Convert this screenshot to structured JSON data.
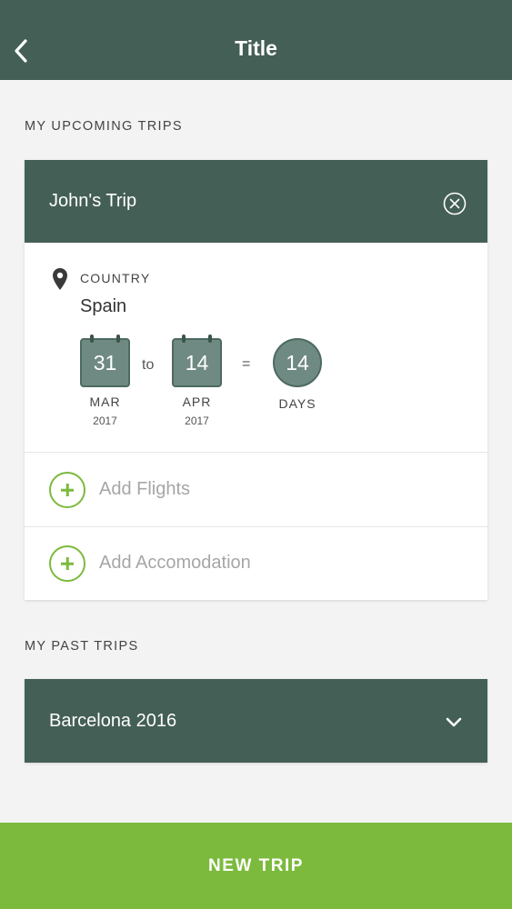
{
  "header": {
    "title": "Title"
  },
  "upcoming": {
    "section_label": "MY UPCOMING TRIPS",
    "trip": {
      "name": "John's Trip",
      "country_label": "COUNTRY",
      "country_value": "Spain",
      "start": {
        "day": "31",
        "month": "MAR",
        "year": "2017"
      },
      "to_text": "to",
      "end": {
        "day": "14",
        "month": "APR",
        "year": "2017"
      },
      "equals_text": "=",
      "duration": {
        "value": "14",
        "label": "DAYS"
      },
      "actions": {
        "add_flights": "Add Flights",
        "add_accommodation": "Add Accomodation"
      }
    }
  },
  "past": {
    "section_label": "MY PAST TRIPS",
    "trip": {
      "name": "Barcelona 2016"
    }
  },
  "footer": {
    "new_trip_label": "NEW TRIP"
  },
  "colors": {
    "primary": "#445f56",
    "accent": "#7cba3d",
    "calendar": "#6f8a82",
    "background": "#f3f3f3"
  },
  "icons": {
    "back": "chevron-left-icon",
    "close": "close-circle-icon",
    "location": "map-pin-icon",
    "add": "plus-circle-icon",
    "expand": "chevron-down-icon"
  }
}
